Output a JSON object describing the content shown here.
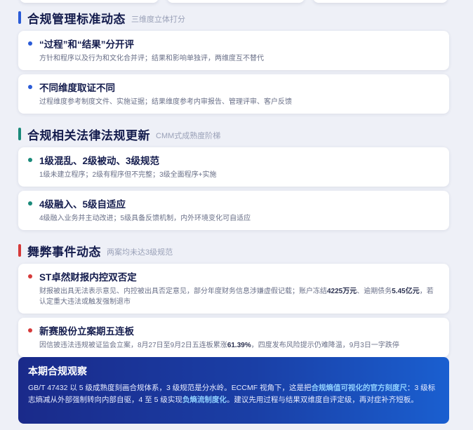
{
  "colors": {
    "blue_accent": "#2a5bd7",
    "teal_accent": "#1a8a7a",
    "red_accent": "#d63a3a",
    "title_text": "#141c4d",
    "muted_text": "#6a7088"
  },
  "sections": [
    {
      "title": "合规管理标准动态",
      "subtitle": "三维度立体打分",
      "cards": [
        {
          "title": "“过程”和“结果”分开评",
          "desc": "方针和程序以及行为和文化合并评；结果和影响单独评，两维度互不替代"
        },
        {
          "title": "不同维度取证不同",
          "desc": "过程维度参考制度文件、实施证据；结果维度参考内审报告、管理评审、客户反馈"
        }
      ]
    },
    {
      "title": "合规相关法律法规更新",
      "subtitle": "CMM式成熟度阶梯",
      "cards": [
        {
          "title": "1级混乱、2级被动、3级规范",
          "desc": "1级未建立程序；2级有程序但不完整；3级全面程序+实施"
        },
        {
          "title": "4级融入、5级自适应",
          "desc": "4级融入业务并主动改进；5级具备反馈机制，内外环境变化可自适应"
        }
      ]
    },
    {
      "title": "舞弊事件动态",
      "subtitle": "两案均未达3级规范",
      "cards": [
        {
          "title": "ST卓然财报内控双否定",
          "desc_parts": [
            "财报被出具无法表示意见、内控被出具否定意见，部分年度财务信息涉嫌虚假记载；账户冻结",
            "4225万元",
            "、逾期债务",
            "5.45亿元",
            "，若认定重大违法或触发强制退市"
          ]
        },
        {
          "title": "新赛股份立案期五连板",
          "desc_parts": [
            "因信披违法违规被证监会立案，8月27日至9月2日五连板累涨",
            "61.39%",
            "，四度发布风险提示仍难降温，9月3日一字跌停"
          ]
        }
      ]
    }
  ],
  "observation": {
    "title": "本期合规观察",
    "parts": [
      "GB/T 47432 以 5 级成熟度刻画合规体系，3 级规范是分水岭。ECCMF 视角下，这是把",
      "合规熵值可视化的官方刻度尺",
      "：3 级标志熵减从外部强制转向内部自驱，4 至 5 级实现",
      "负熵流制度化",
      "。建议先用过程与结果双维度自评定级，再对症补齐短板。"
    ]
  }
}
